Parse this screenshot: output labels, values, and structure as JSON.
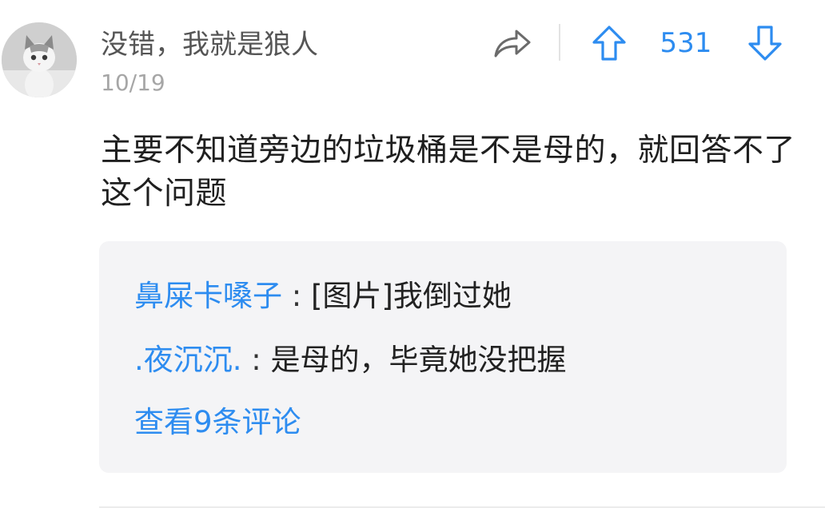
{
  "comment": {
    "username": "没错，我就是狼人",
    "date": "10/19",
    "vote_count": "531",
    "content": "主要不知道旁边的垃圾桶是不是母的，就回答不了这个问题",
    "avatar_icon": "cat-avatar",
    "share_icon": "share-arrow-icon",
    "upvote_icon": "arrow-up-icon",
    "downvote_icon": "arrow-down-icon",
    "accent_color": "#2d8cf0"
  },
  "replies": [
    {
      "author": "鼻屎卡嗓子",
      "separator": " : ",
      "text": "[图片]我倒过她"
    },
    {
      "author": ".夜沉沉.",
      "separator": " : ",
      "text": "是母的，毕竟她没把握"
    }
  ],
  "more_replies_label": "查看9条评论"
}
